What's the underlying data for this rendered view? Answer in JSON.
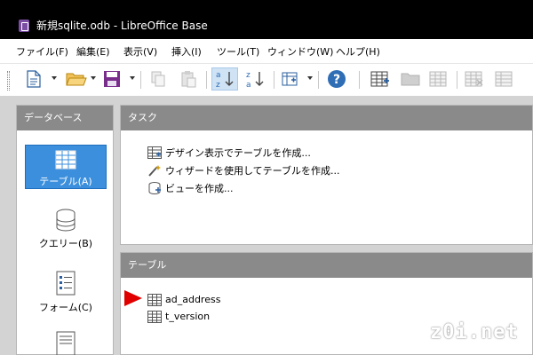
{
  "window": {
    "title": "新規sqlite.odb - LibreOffice Base"
  },
  "menu": [
    {
      "label": "ファイル(F)"
    },
    {
      "label": "編集(E)"
    },
    {
      "label": "表示(V)"
    },
    {
      "label": "挿入(I)"
    },
    {
      "label": "ツール(T)"
    },
    {
      "label": "ウィンドウ(W)"
    },
    {
      "label": "ヘルプ(H)"
    }
  ],
  "toolbar": {
    "icons": [
      "new-document-icon",
      "open-folder-icon",
      "save-icon",
      "copy-icon",
      "paste-icon",
      "sort-ascending-icon",
      "sort-descending-icon",
      "form-design-icon",
      "help-icon",
      "new-table-icon",
      "folder-icon",
      "edit-table-icon",
      "delete-table-icon",
      "table-properties-icon"
    ],
    "pressed": "sort-ascending-icon"
  },
  "database_panel": {
    "header": "データベース",
    "items": [
      {
        "label": "テーブル(A)",
        "icon": "table-icon",
        "selected": true
      },
      {
        "label": "クエリー(B)",
        "icon": "database-cylinder-icon",
        "selected": false
      },
      {
        "label": "フォーム(C)",
        "icon": "form-icon",
        "selected": false
      },
      {
        "label": "",
        "icon": "report-icon",
        "selected": false
      }
    ]
  },
  "tasks_panel": {
    "header": "タスク",
    "items": [
      {
        "label": "デザイン表示でテーブルを作成...",
        "icon": "table-design-icon"
      },
      {
        "label": "ウィザードを使用してテーブルを作成...",
        "icon": "wizard-wand-icon"
      },
      {
        "label": "ビューを作成...",
        "icon": "view-icon"
      }
    ]
  },
  "tables_panel": {
    "header": "テーブル",
    "items": [
      {
        "label": "ad_address",
        "icon": "table-icon"
      },
      {
        "label": "t_version",
        "icon": "table-icon"
      }
    ]
  },
  "annotation": {
    "icon": "red-arrow-icon",
    "color": "#e00000"
  },
  "watermark": {
    "text": "z0i.net"
  },
  "colors": {
    "selected": "#3c8fdc",
    "panel_header": "#8a8a8a",
    "workarea": "#d3d3d3",
    "titlebar": "#000000"
  }
}
